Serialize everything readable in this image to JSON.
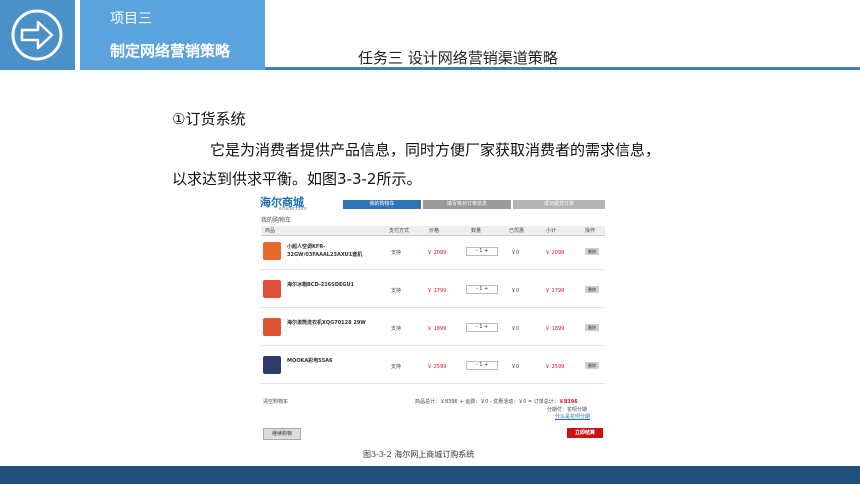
{
  "header": {
    "project_label": "项目三",
    "project_title": "制定网络营销策略",
    "task_title": "任务三   设计网络营销渠道策略",
    "icon": "arrow-circle-icon"
  },
  "content": {
    "heading": "①订货系统",
    "para1": "它是为消费者提供产品信息，同时方便厂家获取消费者的需求信息，",
    "para2": "以求达到供求平衡。如图3-3-2所示。"
  },
  "screenshot": {
    "logo": "海尔商城",
    "logo_sub": "ehaier.com",
    "steps": [
      "我的购物车",
      "填写核对订单信息",
      "成功提交订单"
    ],
    "cart_title": "我的购物车",
    "columns": [
      "商品",
      "支付方式",
      "价格",
      "数量",
      "已优惠",
      "小计",
      "操作"
    ],
    "rows": [
      {
        "name": "小超人空调KFR-32GW/03FAAAL23AXU1套机",
        "pay": "支持",
        "price": "￥ 2099",
        "qty": "-  1  +",
        "discount": "￥0",
        "subtotal": "￥ 2099",
        "op": "删除",
        "color": "#e8672b"
      },
      {
        "name": "海尔冰箱BCD-216SDEGU1",
        "pay": "支持",
        "price": "￥ 1799",
        "qty": "-  1  +",
        "discount": "￥0",
        "subtotal": "￥ 1799",
        "op": "删除",
        "color": "#e04f3a"
      },
      {
        "name": "海尔滚筒洗衣机XQG70128 29W",
        "pay": "支持",
        "price": "￥ 1899",
        "qty": "-  1  +",
        "discount": "￥0",
        "subtotal": "￥ 1899",
        "op": "删除",
        "color": "#e05438"
      },
      {
        "name": "MOOKA彩电55A6",
        "pay": "支持",
        "price": "￥ 2599",
        "qty": "-  1  +",
        "discount": "￥0",
        "subtotal": "￥ 2599",
        "op": "删除",
        "color": "#2c3d6b"
      }
    ],
    "clear_cart": "清空购物车",
    "summary_prefix": "商品总计：￥8396 + 运费：￥0 - 优惠活动：￥0 = 订单总计：",
    "summary_total": "￥8396",
    "coupon": "分期付：花呗分期",
    "coupon_link": "什么是花呗分期",
    "continue_btn": "继续购物",
    "submit_btn": "立即结算"
  },
  "caption": "图3-3-2 海尔网上商城订购系统",
  "colors": {
    "header_blue": "#5ba3dc",
    "bottom_bar": "#1f4f7a",
    "accent_red": "#cc1111"
  }
}
